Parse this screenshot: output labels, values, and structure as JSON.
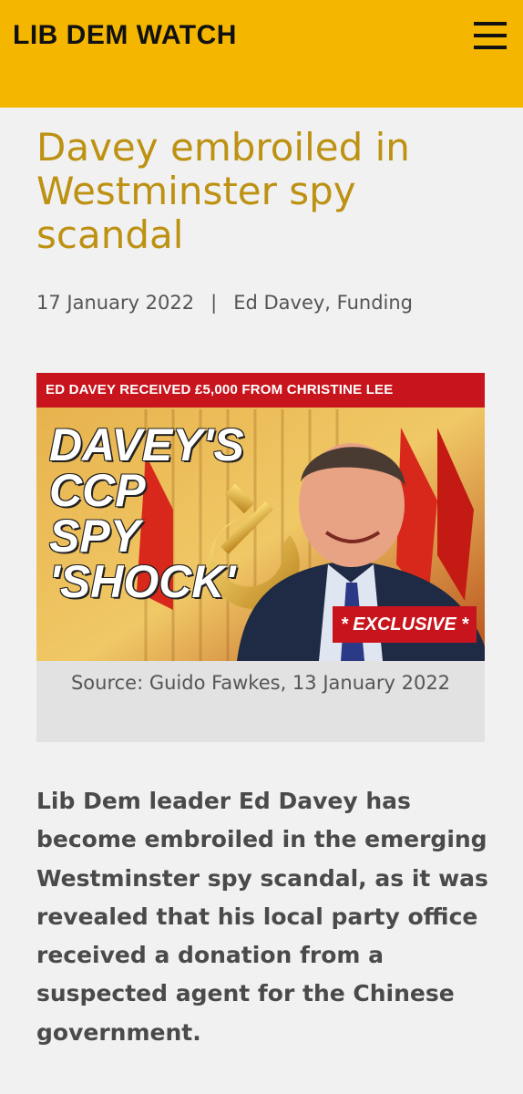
{
  "header": {
    "brand": "LIB DEM WATCH",
    "menu_icon": "hamburger-menu-icon",
    "background_color": "#f5b600"
  },
  "article": {
    "title": "Davey embroiled in Westminster spy scandal",
    "date": "17 January 2022",
    "separator": "|",
    "categories": "Ed Davey, Funding",
    "title_color": "#bd9112"
  },
  "figure": {
    "banner_text": "ED DAVEY RECEIVED £5,000 FROM CHRISTINE LEE",
    "headline_lines": [
      "DAVEY'S",
      "CCP",
      "SPY",
      "'SHOCK'"
    ],
    "badge_text": "* EXCLUSIVE *",
    "caption": "Source: Guido Fawkes, 13 January 2022",
    "accent_color": "#c8141c"
  },
  "body": {
    "lead": "Lib Dem leader Ed Davey has become embroiled in the emerging Westminster spy scandal, as it was revealed that his local party office received a donation from a suspected agent for the Chinese government."
  }
}
